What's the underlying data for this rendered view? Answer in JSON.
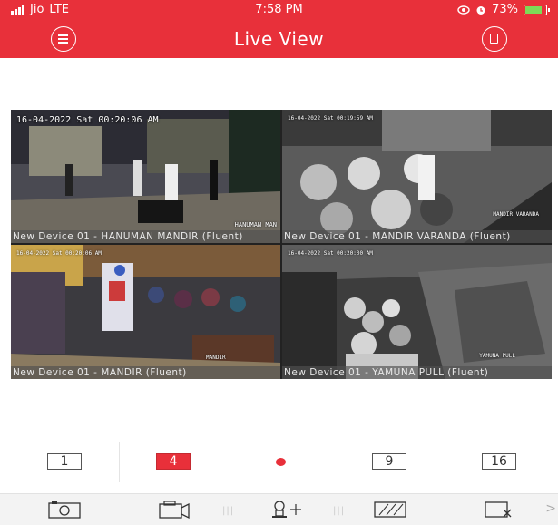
{
  "status_bar": {
    "carrier": "Jio",
    "network": "LTE",
    "time": "7:58 PM",
    "battery_percent": "73%",
    "battery_level": 0.73,
    "icons": [
      "signal-icon",
      "eye-icon",
      "alarm-icon",
      "battery-charging-icon"
    ]
  },
  "app_bar": {
    "title": "Live View",
    "left_icon": "menu-icon",
    "right_icon": "layout-toggle-icon"
  },
  "cameras": [
    {
      "timestamp": "16-04-2022 Sat 00:20:06 AM",
      "overlay_tag": "HANUMAN MAN",
      "label": "New Device 01 - HANUMAN MANDIR (Fluent)",
      "selected": false
    },
    {
      "timestamp": "16-04-2022 Sat 00:19:59 AM",
      "overlay_tag": "MANDIR VARANDA",
      "label": "New Device 01 - MANDIR VARANDA (Fluent)",
      "selected": false
    },
    {
      "timestamp": "16-04-2022 Sat 00:20:06 AM",
      "overlay_tag": "MANDIR",
      "label": "New Device 01 - MANDIR (Fluent)",
      "selected": false
    },
    {
      "timestamp": "16-04-2022 Sat 00:20:00 AM",
      "overlay_tag": "YAMUNA PULL",
      "label": "New Device 01 - YAMUNA PULL (Fluent)",
      "selected": true
    }
  ],
  "layout_options": [
    {
      "label": "1",
      "active": false
    },
    {
      "label": "4",
      "active": true
    },
    {
      "label": "9",
      "active": false
    },
    {
      "label": "16",
      "active": false
    }
  ],
  "toolbar": {
    "icons": [
      "camera-snapshot-icon",
      "record-icon",
      "ptz-icon",
      "image-quality-icon",
      "stop-all-icon"
    ],
    "more_glyph": ">"
  },
  "colors": {
    "brand_red": "#e8303a",
    "selected_border": "#e0b12a"
  }
}
